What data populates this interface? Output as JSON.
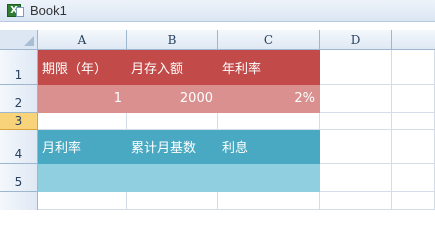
{
  "window": {
    "title": "Book1",
    "icon": "excel-workbook-icon"
  },
  "columns": [
    "A",
    "B",
    "C",
    "D"
  ],
  "rows": [
    "1",
    "2",
    "3",
    "4",
    "5"
  ],
  "cells": {
    "A1": "期限（年）",
    "B1": "月存入额",
    "C1": "年利率",
    "A2": "1",
    "B2": "2000",
    "C2": "2%",
    "A4": "月利率",
    "B4": "累计月基数",
    "C4": "利息"
  },
  "active_row": "3",
  "colors": {
    "header_red": "#c24a48",
    "value_red": "#d9908e",
    "header_teal": "#4aa9c2",
    "value_teal": "#8fcfe0"
  }
}
